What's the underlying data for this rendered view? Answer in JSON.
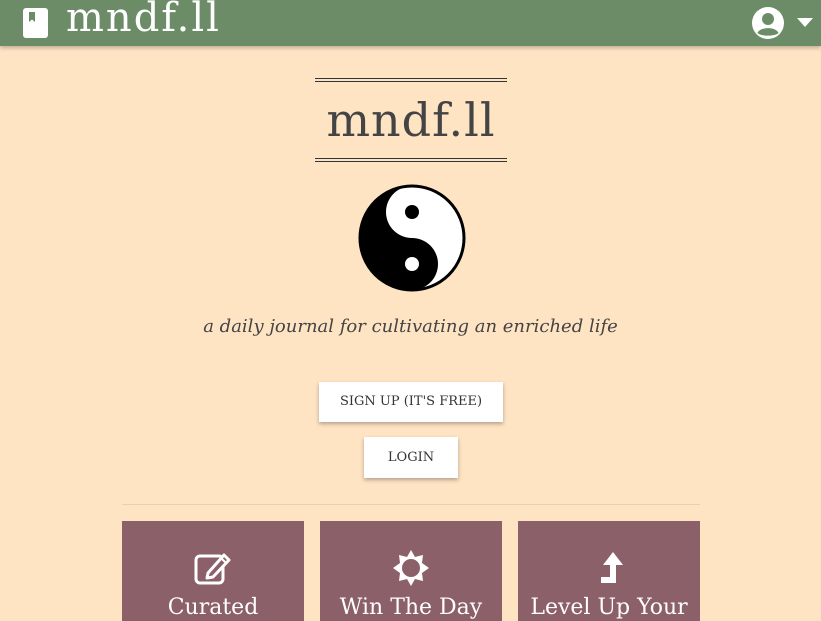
{
  "navbar": {
    "brand": "mndf.ll",
    "brand_icon": "book-icon",
    "user_icon": "user-circle-icon",
    "caret_icon": "caret-down-icon",
    "background_color": "#6b8c67"
  },
  "hero": {
    "title": "mndf.ll",
    "logo_icon": "yin-yang-icon",
    "tagline": "a daily journal for cultivating an enriched life"
  },
  "actions": {
    "signup_label": "SIGN UP (IT'S FREE)",
    "login_label": "LOGIN"
  },
  "features": [
    {
      "title": "Curated",
      "icon": "edit-icon"
    },
    {
      "title": "Win The Day",
      "icon": "sun-icon"
    },
    {
      "title": "Level Up Your",
      "icon": "level-up-icon"
    }
  ],
  "colors": {
    "page_background": "#ffe4c4",
    "card_background": "#8b6069",
    "button_background": "#ffffff"
  }
}
